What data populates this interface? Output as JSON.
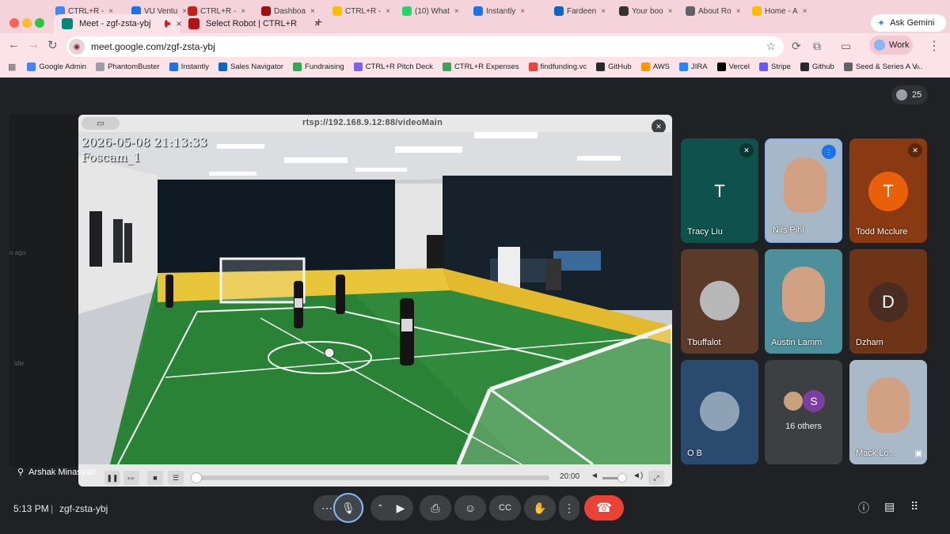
{
  "browser": {
    "top_tabs": [
      {
        "label": "CTRL+R -",
        "color": "#4285f4"
      },
      {
        "label": "VU Ventu",
        "color": "#1a73e8"
      },
      {
        "label": "CTRL+R -",
        "color": "#c5221f"
      },
      {
        "label": "Dashboa",
        "color": "#a50e0e"
      },
      {
        "label": "CTRL+R -",
        "color": "#fbbc04"
      },
      {
        "label": "(10) What",
        "color": "#25d366"
      },
      {
        "label": "Instantly",
        "color": "#1a73e8"
      },
      {
        "label": "Fardeen",
        "color": "#0a66c2"
      },
      {
        "label": "Your boo",
        "color": "#333333"
      },
      {
        "label": "About Ro",
        "color": "#5f6368"
      },
      {
        "label": "Home - A",
        "color": "#fbbc04"
      }
    ],
    "active_tab": {
      "label": "Meet - zgf-zsta-ybj",
      "close": "×"
    },
    "second_tab": {
      "label": "Select Robot | CTRL+R",
      "close": "×"
    },
    "new_tab": "+",
    "ask_gemini": "Ask Gemini",
    "url": "meet.google.com/zgf-zsta-ybj",
    "profile": "Work",
    "bookmarks": [
      {
        "label": "Google Admin",
        "color": "#4285f4"
      },
      {
        "label": "PhantomBuster",
        "color": "#9aa0a6"
      },
      {
        "label": "Instantly",
        "color": "#1a73e8"
      },
      {
        "label": "Sales Navigator",
        "color": "#0a66c2"
      },
      {
        "label": "Fundraising",
        "color": "#34a853"
      },
      {
        "label": "CTRL+R Pitch Deck",
        "color": "#7b61ff"
      },
      {
        "label": "CTRL+R Expenses",
        "color": "#34a853"
      },
      {
        "label": "findfunding.vc",
        "color": "#e8453c"
      },
      {
        "label": "GitHub",
        "color": "#24292e"
      },
      {
        "label": "AWS",
        "color": "#ff9900"
      },
      {
        "label": "JIRA",
        "color": "#2684ff"
      },
      {
        "label": "Vercel",
        "color": "#000000"
      },
      {
        "label": "Stripe",
        "color": "#635bff"
      },
      {
        "label": "Github",
        "color": "#24292e"
      },
      {
        "label": "Seed & Series A V...",
        "color": "#5f6368"
      }
    ],
    "more_bookmarks": "»"
  },
  "meet": {
    "participant_count": "25",
    "left_ghost_text_1": "o ago",
    "left_ghost_text_2": "idle",
    "presenter_name": "Arshak Minasyan",
    "stream": {
      "url": "rtsp://192.168.9.12:88/videoMain",
      "timestamp": "2026-05-08 21:13:33",
      "camera": "Foscam_1",
      "time": "20:00",
      "progress": 0.0
    },
    "participants": [
      {
        "name": "Tracy Liu",
        "initial": "T",
        "bg": "#0f524d",
        "avatar": "#0f524d",
        "muted": true
      },
      {
        "name": "Nils Pihl",
        "initial": "",
        "bg": "#a6b8c7",
        "avatar": "",
        "muted": false,
        "speaking": true
      },
      {
        "name": "Todd Mcclure",
        "initial": "T",
        "bg": "#8a3a12",
        "avatar": "#e8600a",
        "muted": true
      },
      {
        "name": "Tbuffalot",
        "initial": "",
        "bg": "#5c3a2a",
        "avatar": "",
        "muted": false
      },
      {
        "name": "Austin Lamm",
        "initial": "",
        "bg": "#4d8f9a",
        "avatar": "",
        "muted": false
      },
      {
        "name": "Dzham",
        "initial": "D",
        "bg": "#6e3418",
        "avatar": "#4b2c20",
        "muted": false
      },
      {
        "name": "O B",
        "initial": "",
        "bg": "#2a4a6e",
        "avatar": "",
        "muted": false
      },
      {
        "name": "16 others",
        "initial": "S",
        "bg": "#3c4043",
        "avatar": "#7b3fa0",
        "muted": false
      },
      {
        "name": "Mack Lo...",
        "initial": "",
        "bg": "#a9b9c8",
        "avatar": "",
        "muted": false
      }
    ],
    "clock": "5:13 PM",
    "separator": "|",
    "meeting_code": "zgf-zsta-ybj"
  }
}
